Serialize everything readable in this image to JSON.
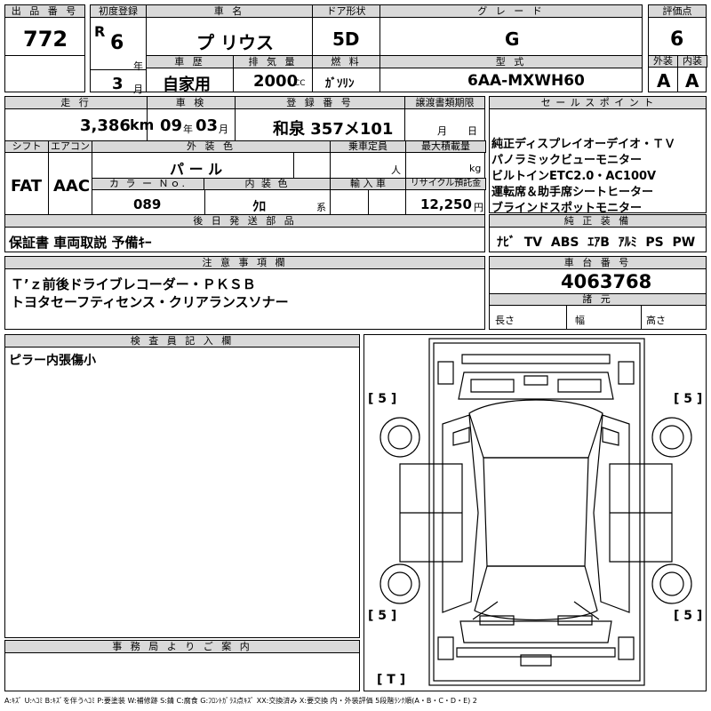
{
  "header": {
    "lot_label": "出 品 番 号",
    "lot_value": "772",
    "first_reg_label": "初度登録",
    "era": "R",
    "year": "6",
    "year_unit": "年",
    "month": "3",
    "month_unit": "月",
    "car_name_label": "車 名",
    "car_name": "プ リウス",
    "door_label": "ドア形状",
    "door": "5D",
    "grade_label": "グ レ ー ド",
    "grade": "G",
    "score_label": "評価点",
    "score": "6",
    "history_label": "車 歴",
    "history": "自家用",
    "displacement_label": "排 気 量",
    "displacement": "2000",
    "cc": "CC",
    "fuel_label": "燃 料",
    "fuel": "ｶﾞｿﾘﾝ",
    "model_label": "型 式",
    "model": "6AA-MXWH60",
    "ext_label": "外装",
    "int_label": "内装",
    "ext": "A",
    "int": "A"
  },
  "row2": {
    "mileage_label": "走 行",
    "mileage": "3,386",
    "km": "km",
    "inspection_label": "車 検",
    "insp_year": "09",
    "insp_year_unit": "年",
    "insp_month": "03",
    "insp_month_unit": "月",
    "plate_label": "登 録 番 号",
    "plate": "和泉 357メ101",
    "transfer_label": "譲渡書類期限",
    "transfer_month": "月",
    "transfer_day": "日",
    "sales_label": "セ ー ル ス ポ イ ン ト",
    "sales_points": [
      "純正ディスプレイオーデイオ・ＴＶ",
      "パノラミックビューモニター",
      "ビルトインETC2.0・AC100V",
      "運転席＆助手席シートヒーター",
      "ブラインドスポットモニター"
    ]
  },
  "row3": {
    "shift_label": "シフト",
    "shift": "FAT",
    "ac_label": "エアコン",
    "ac": "AAC",
    "ext_color_label": "外 装 色",
    "ext_color": "パ ー ル",
    "capacity_label": "乗車定員",
    "capacity_unit": "人",
    "load_label": "最大積載量",
    "load_unit": "kg",
    "color_no_label": "カ ラ ー Ｎｏ.",
    "color_no": "089",
    "int_color_label": "内 装 色",
    "int_color": "ｸﾛ",
    "int_color_suffix": "系",
    "import_label": "輸 入 車",
    "recycle_label": "リサイクル預託金",
    "recycle": "12,250",
    "recycle_unit": "円"
  },
  "later_parts": {
    "label": "後 日 発 送 部 品",
    "value": "保証書 車両取説 予備ｷｰ"
  },
  "equipment": {
    "label": "純 正 装 備",
    "items": "ﾅﾋﾞ  TV  ABS  ｴｱB  ｱﾙﾐ  PS  PW"
  },
  "notes": {
    "label": "注 意 事 項 欄",
    "lines": [
      "Ｔ’ｚ前後ドライブレコーダー・ＰＫＳＢ",
      "トヨタセーフティセンス・クリアランスソナー"
    ]
  },
  "chassis": {
    "label": "車 台 番 号",
    "value": "4063768",
    "specs_label": "諸 元",
    "length": "長さ",
    "width": "幅",
    "height": "高さ"
  },
  "inspector": {
    "label": "検 査 員 記 入 欄",
    "text": "ピラー内張傷小"
  },
  "office": {
    "label": "事 務 局 よ り ご 案 内"
  },
  "diagram": {
    "tl": "[ 5 ]",
    "tr": "[ 5 ]",
    "bl": "[ 5 ]",
    "br": "[ 5 ]",
    "bottom": "[ T ]"
  },
  "legend": "A:ｷｽﾞ U:ﾍｺﾐ B:ｷｽﾞを伴うﾍｺﾐ P:要塗装 W:補修跡 S:錆 C:腐食 G:ﾌﾛﾝﾄｶﾞﾗｽ点ｷｽﾞ XX:交換済み X:要交換 内・外装評価 5段階ﾗﾝｸ順(A・B・C・D・E) 2"
}
